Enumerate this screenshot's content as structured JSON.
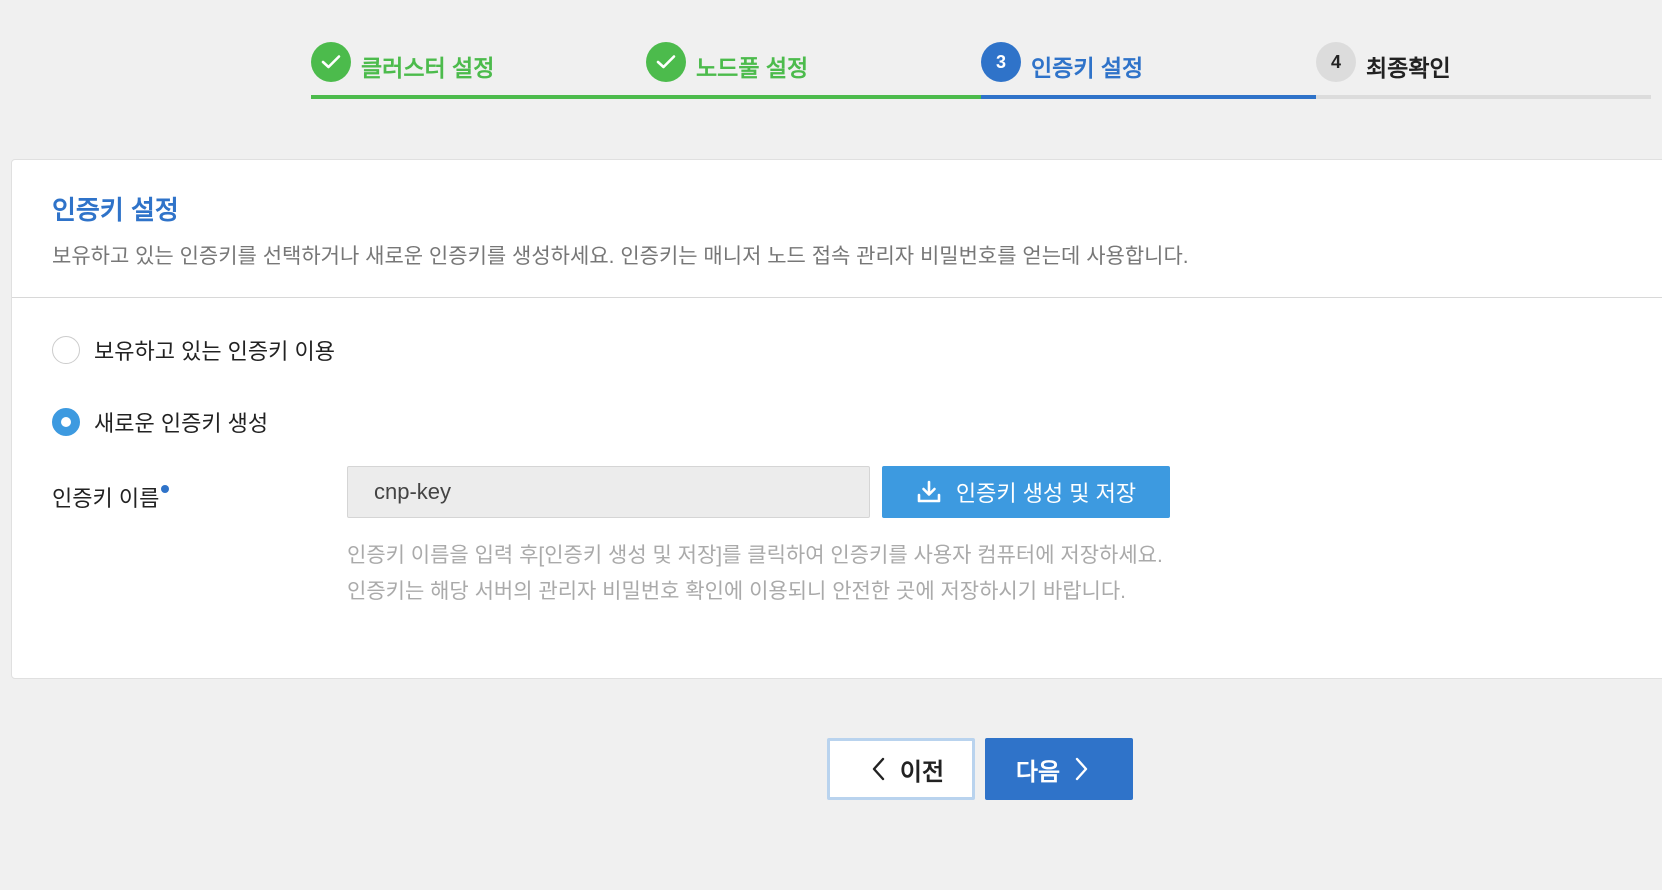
{
  "stepper": {
    "steps": [
      {
        "number": "",
        "label": "클러스터 설정",
        "state": "done"
      },
      {
        "number": "",
        "label": "노드풀 설정",
        "state": "done"
      },
      {
        "number": "3",
        "label": "인증키 설정",
        "state": "active"
      },
      {
        "number": "4",
        "label": "최종확인",
        "state": "todo"
      }
    ]
  },
  "card": {
    "title": "인증키 설정",
    "description": "보유하고 있는 인증키를 선택하거나 새로운 인증키를 생성하세요. 인증키는 매니저 노드 접속 관리자 비밀번호를 얻는데 사용합니다.",
    "options": [
      {
        "label": "보유하고 있는 인증키 이용",
        "checked": false
      },
      {
        "label": "새로운 인증키 생성",
        "checked": true
      }
    ],
    "key_name_label": "인증키 이름",
    "key_name_value": "cnp-key",
    "generate_button": "인증키 생성 및 저장",
    "help_line1": "인증키 이름을 입력 후[인증키 생성 및 저장]를 클릭하여 인증키를 사용자 컴퓨터에 저장하세요.",
    "help_line2": "인증키는 해당 서버의 관리자 비밀번호 확인에 이용되니 안전한 곳에 저장하시기 바랍니다."
  },
  "nav": {
    "prev_label": "이전",
    "next_label": "다음"
  },
  "colors": {
    "done": "#4cbb4c",
    "active": "#2f73c9",
    "todo": "#dcdcdc",
    "button_light": "#3d9ae0"
  }
}
